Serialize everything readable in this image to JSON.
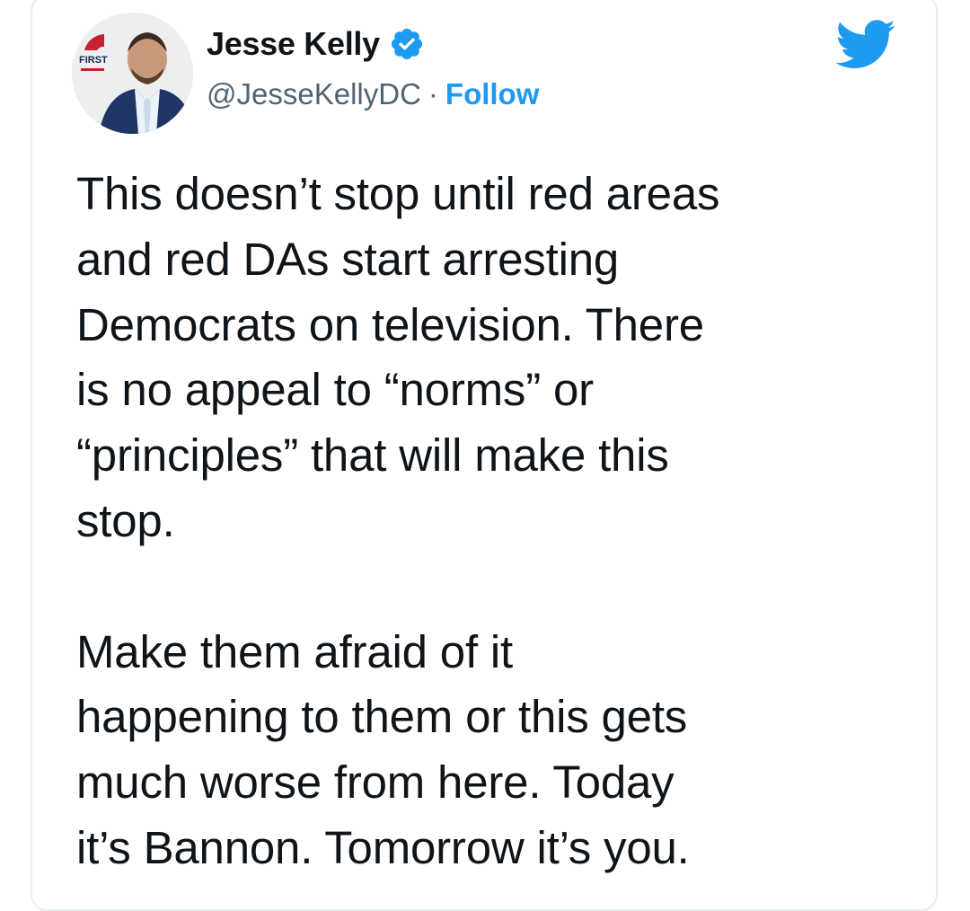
{
  "author": {
    "display_name": "Jesse Kelly",
    "handle": "@JesseKellyDC",
    "separator": "·",
    "follow_label": "Follow",
    "verified": true,
    "avatar_badge_text": "FIRST"
  },
  "icons": {
    "brand": "twitter-bird-icon",
    "verified": "verified-badge-icon"
  },
  "colors": {
    "twitter_blue": "#1d9bf0",
    "text": "#0f1419",
    "secondary_text": "#536471"
  },
  "tweet": {
    "paragraphs": [
      {
        "lines": [
          "This doesn’t stop until red areas",
          "and red DAs start arresting",
          "Democrats on television. There",
          "is no appeal to “norms” or",
          "“principles” that will make this",
          "stop."
        ]
      },
      {
        "lines": [
          "Make them afraid of it",
          "happening to them or this gets",
          "much worse from here. Today",
          "it’s Bannon. Tomorrow it’s you."
        ]
      }
    ]
  }
}
